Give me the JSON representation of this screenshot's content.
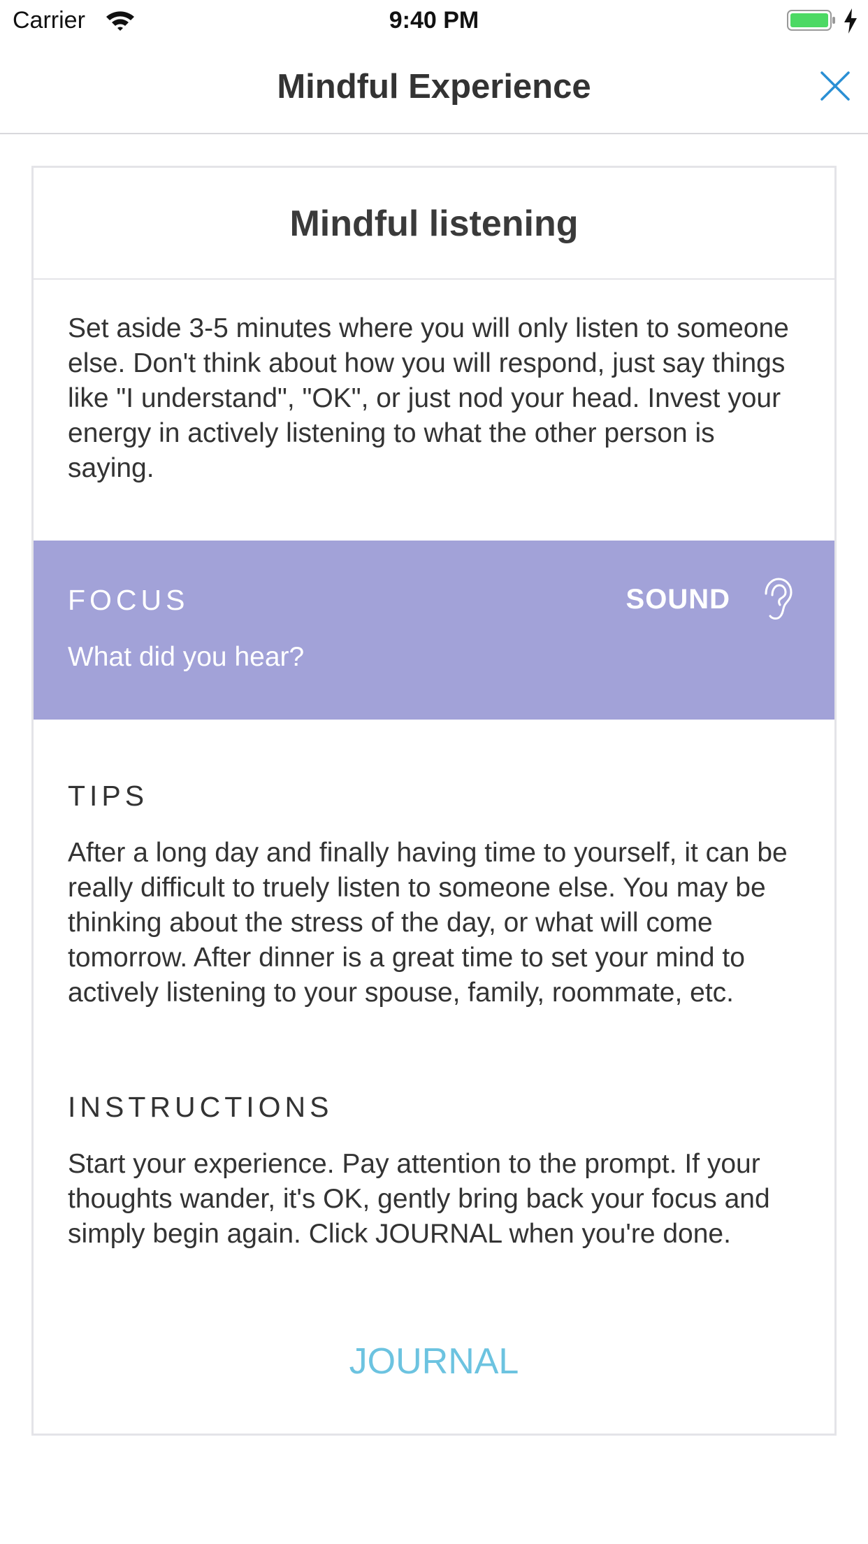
{
  "status_bar": {
    "carrier": "Carrier",
    "time": "9:40 PM",
    "icons": [
      "wifi-icon",
      "battery-icon",
      "charging-bolt-icon"
    ],
    "battery_color": "#4cd964"
  },
  "nav": {
    "title": "Mindful Experience",
    "close_icon": "close-icon",
    "accent_color": "#2a8fd4"
  },
  "card": {
    "title": "Mindful listening",
    "description": "Set aside 3-5 minutes where you will only listen to someone else. Don't think about how you will respond, just say things like \"I understand\", \"OK\", or just nod your head. Invest your energy in actively listening to what the other person is saying.",
    "focus": {
      "label": "FOCUS",
      "question": "What did you hear?",
      "sense": "SOUND",
      "sense_icon": "ear-icon",
      "background_color": "#a2a2d8"
    },
    "tips": {
      "heading": "TIPS",
      "body": "After a long day and finally having time to yourself, it can be really difficult to truely listen to someone else. You may be thinking about the stress of the day, or what will come tomorrow. After dinner is a great time to set your mind to actively listening to your spouse, family, roommate, etc."
    },
    "instructions": {
      "heading": "INSTRUCTIONS",
      "body": "Start your experience. Pay attention to the prompt. If your thoughts wander, it's OK, gently bring back your focus and simply begin again. Click JOURNAL when you're done."
    },
    "journal_button": "JOURNAL",
    "journal_color": "#6cc3e0"
  }
}
